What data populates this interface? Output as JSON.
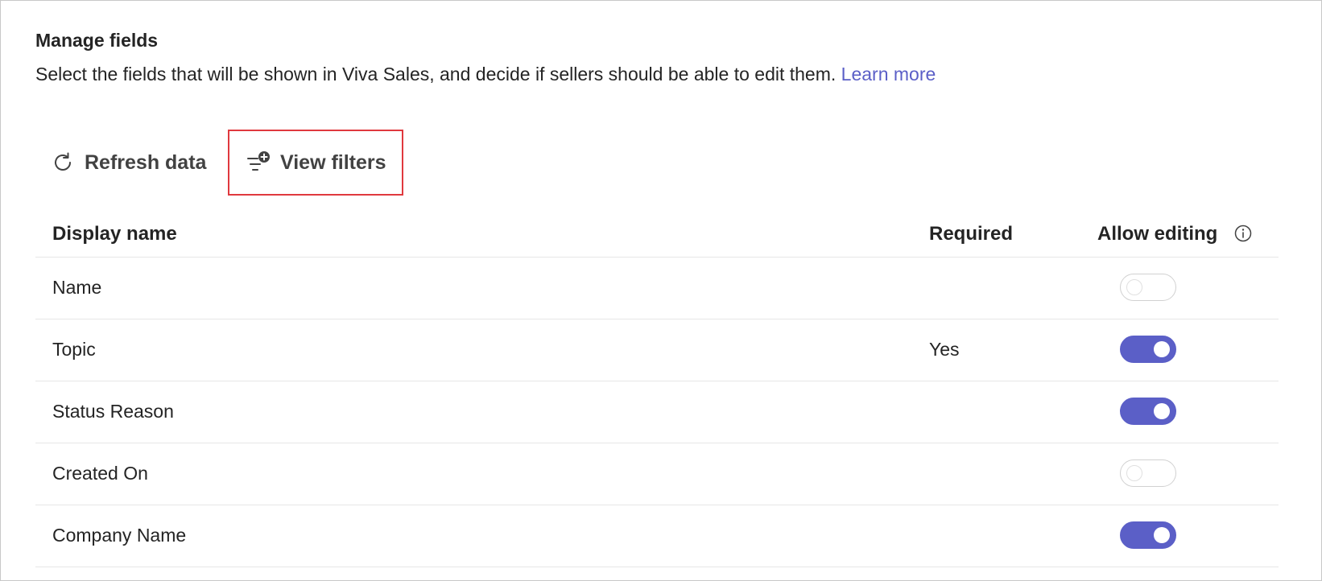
{
  "header": {
    "title": "Manage fields",
    "description": "Select the fields that will be shown in Viva Sales, and decide if sellers should be able to edit them.",
    "learn_more": "Learn more"
  },
  "toolbar": {
    "refresh_label": "Refresh data",
    "refresh_icon": "refresh-icon",
    "filters_label": "View filters",
    "filters_icon": "filter-add-icon"
  },
  "table": {
    "columns": {
      "display_name": "Display name",
      "required": "Required",
      "allow_editing": "Allow editing"
    },
    "info_icon": "info-icon",
    "rows": [
      {
        "name": "Name",
        "required": "",
        "allow_editing": false
      },
      {
        "name": "Topic",
        "required": "Yes",
        "allow_editing": true
      },
      {
        "name": "Status Reason",
        "required": "",
        "allow_editing": true
      },
      {
        "name": "Created On",
        "required": "",
        "allow_editing": false
      },
      {
        "name": "Company Name",
        "required": "",
        "allow_editing": true
      }
    ]
  },
  "colors": {
    "accent": "#5b5fc7",
    "highlight_border": "#e0393e",
    "text": "#242424"
  }
}
